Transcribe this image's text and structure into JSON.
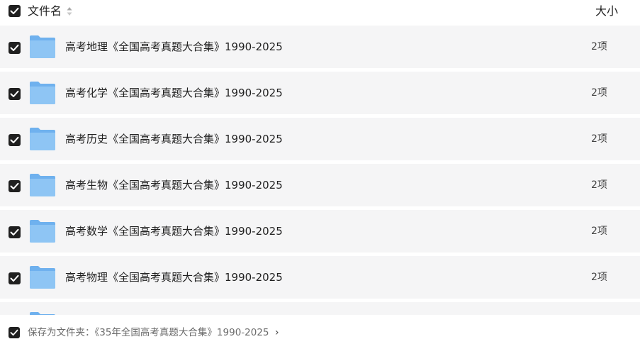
{
  "header": {
    "name_label": "文件名",
    "size_label": "大小",
    "sort_icon": "sort-icon",
    "select_all_checked": true
  },
  "files": [
    {
      "name": "高考地理《全国高考真题大合集》1990-2025",
      "size": "2项",
      "checked": true
    },
    {
      "name": "高考化学《全国高考真题大合集》1990-2025",
      "size": "2项",
      "checked": true
    },
    {
      "name": "高考历史《全国高考真题大合集》1990-2025",
      "size": "2项",
      "checked": true
    },
    {
      "name": "高考生物《全国高考真题大合集》1990-2025",
      "size": "2项",
      "checked": true
    },
    {
      "name": "高考数学《全国高考真题大合集》1990-2025",
      "size": "2项",
      "checked": true
    },
    {
      "name": "高考物理《全国高考真题大合集》1990-2025",
      "size": "2项",
      "checked": true
    }
  ],
  "footer": {
    "save_label": "保存为文件夹：《35年全国高考真题大合集》1990-2025",
    "chevron": "›",
    "checked": true
  },
  "colors": {
    "checkbox": "#1f1f1f",
    "row_bg": "#f5f5f6",
    "folder_light": "#8ec5f4",
    "folder_dark": "#6fb1ee"
  }
}
